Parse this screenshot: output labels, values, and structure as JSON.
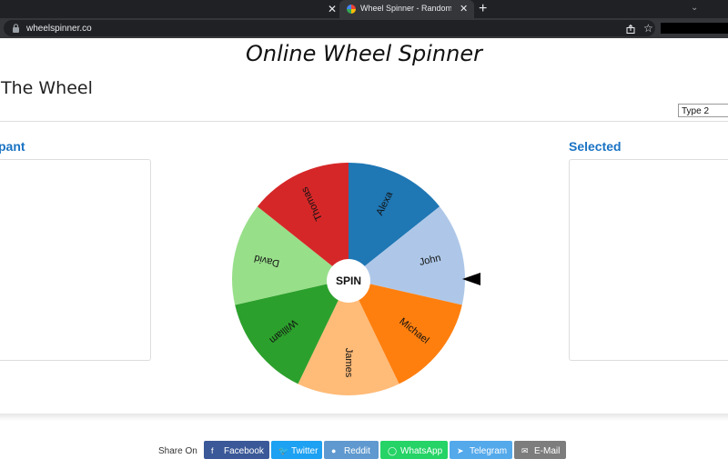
{
  "browser": {
    "tab_title": "Wheel Spinner - Random Name P",
    "url": "wheelspinner.co",
    "close_glyph": "✕",
    "new_tab_glyph": "+",
    "menu_glyph": "⌄",
    "star_glyph": "☆"
  },
  "page": {
    "title": "Online Wheel Spinner",
    "section_title": "The Wheel",
    "type_select_value": "Type 2",
    "participants_heading": "pant",
    "selected_heading": "Selected"
  },
  "wheel": {
    "spin_label": "SPIN",
    "segments": [
      {
        "name": "Alexa",
        "color": "#1f77b4"
      },
      {
        "name": "John",
        "color": "#aec7e8"
      },
      {
        "name": "Michael",
        "color": "#ff7f0e"
      },
      {
        "name": "James",
        "color": "#ffbb78"
      },
      {
        "name": "William",
        "color": "#2ca02c"
      },
      {
        "name": "David",
        "color": "#98df8a"
      },
      {
        "name": "Thomas",
        "color": "#d62728"
      }
    ]
  },
  "share": {
    "label": "Share On",
    "buttons": [
      {
        "label": "Facebook",
        "icon": "facebook-icon"
      },
      {
        "label": "Twitter",
        "icon": "twitter-icon"
      },
      {
        "label": "Reddit",
        "icon": "reddit-icon"
      },
      {
        "label": "WhatsApp",
        "icon": "whatsapp-icon"
      },
      {
        "label": "Telegram",
        "icon": "telegram-icon"
      },
      {
        "label": "E-Mail",
        "icon": "email-icon"
      }
    ]
  }
}
